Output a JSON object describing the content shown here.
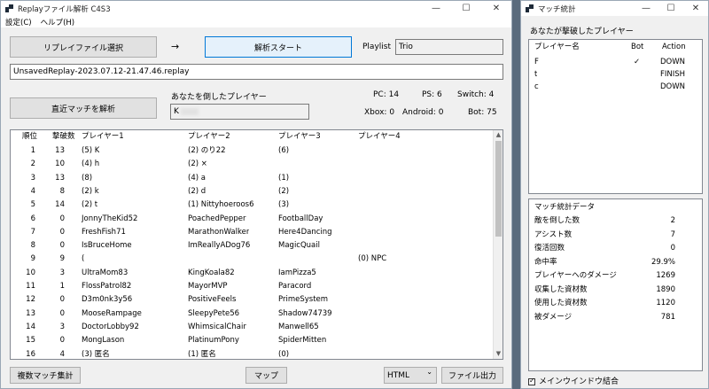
{
  "main": {
    "title": "Replayファイル解析 C4S3",
    "menu": [
      "設定(C)",
      "ヘルプ(H)"
    ],
    "select_file_button": "リプレイファイル選択",
    "arrow": "→",
    "analyze_button": "解析スタート",
    "playlist_label": "Playlist",
    "playlist_value": "Trio",
    "file_path": "UnsavedReplay-2023.07.12-21.47.46.replay",
    "killer_label": "あなたを倒したプレイヤー",
    "killer_value": "K",
    "recent_button": "直近マッチを解析",
    "stats": {
      "pc": "PC: 14",
      "ps": "PS: 6",
      "switch": "Switch: 4",
      "xbox": "Xbox: 0",
      "android": "Android: 0",
      "bot": "Bot: 75"
    },
    "columns": [
      "順位",
      "撃破数",
      "プレイヤー1",
      "プレイヤー2",
      "プレイヤー3",
      "プレイヤー4"
    ],
    "rows": [
      [
        "1",
        "13",
        "(5) K",
        "(2) のり22",
        "(6)",
        ""
      ],
      [
        "2",
        "10",
        "(4) h",
        "(2) ×",
        "",
        ""
      ],
      [
        "3",
        "13",
        "(8)",
        "(4) a",
        "(1)",
        ""
      ],
      [
        "4",
        "8",
        "(2) k",
        "(2) d",
        "(2)",
        ""
      ],
      [
        "5",
        "14",
        "(2) t",
        "(1) Nittyhoeroos6",
        "(3)",
        ""
      ],
      [
        "6",
        "0",
        "JonnyTheKid52",
        "PoachedPepper",
        "FootballDay",
        ""
      ],
      [
        "7",
        "0",
        "FreshFish71",
        "MarathonWalker",
        "Here4Dancing",
        ""
      ],
      [
        "8",
        "0",
        "IsBruceHome",
        "ImReallyADog76",
        "MagicQuail",
        ""
      ],
      [
        "9",
        "9",
        "(",
        "",
        "",
        "(0) NPC"
      ],
      [
        "10",
        "3",
        "UltraMom83",
        "KingKoala82",
        "IamPizza5",
        ""
      ],
      [
        "11",
        "1",
        "FlossPatrol82",
        "MayorMVP",
        "Paracord",
        ""
      ],
      [
        "12",
        "0",
        "D3m0nk3y56",
        "PositiveFeels",
        "PrimeSystem",
        ""
      ],
      [
        "13",
        "0",
        "MooseRampage",
        "SleepyPete56",
        "Shadow74739",
        ""
      ],
      [
        "14",
        "3",
        "DoctorLobby92",
        "WhimsicalChair",
        "Manwell65",
        ""
      ],
      [
        "15",
        "0",
        "MongLason",
        "PlatinumPony",
        "SpiderMitten",
        ""
      ],
      [
        "16",
        "4",
        "(3) 匿名",
        "(1) 匿名",
        "(0)",
        ""
      ]
    ],
    "multi_match_button": "複数マッチ集計",
    "map_button": "マップ",
    "format_value": "HTML",
    "export_button": "ファイル出力"
  },
  "side": {
    "title": "マッチ統計",
    "defeated_label": "あなたが撃破したプレイヤー",
    "defeated_columns": [
      "プレイヤー名",
      "Bot",
      "Action"
    ],
    "defeated_rows": [
      [
        "F",
        "✓",
        "DOWN"
      ],
      [
        "t",
        "",
        "FINISH"
      ],
      [
        "c",
        "",
        "DOWN"
      ]
    ],
    "stats_header": "マッチ統計データ",
    "stats_rows": [
      [
        "敵を倒した数",
        "2"
      ],
      [
        "アシスト数",
        "7"
      ],
      [
        "復活回数",
        "0"
      ],
      [
        "命中率",
        "29.9%"
      ],
      [
        "プレイヤーへのダメージ",
        "1269"
      ],
      [
        "収集した資材数",
        "1890"
      ],
      [
        "使用した資材数",
        "1120"
      ],
      [
        "被ダメージ",
        "781"
      ]
    ],
    "merge_label": "メインウインドウ結合"
  }
}
